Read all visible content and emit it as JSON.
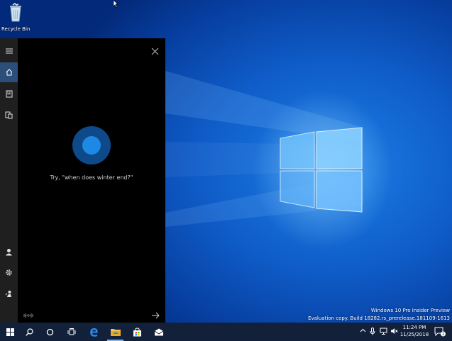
{
  "desktop": {
    "icons": [
      {
        "label": "Recycle Bin",
        "icon": "recycle-bin-icon"
      }
    ]
  },
  "cortana": {
    "suggestion": "Try, \"when does winter end?\"",
    "rail_top": [
      "hamburger-menu-icon",
      "home-icon",
      "notebook-icon",
      "devices-icon"
    ],
    "rail_bottom": [
      "account-icon",
      "settings-icon",
      "feedback-icon"
    ],
    "accent": "#1e88e5"
  },
  "watermark": {
    "line1": "Windows 10 Pro Insider Preview",
    "line2": "Evaluation copy. Build 18282.rs_prerelease.181109-1613"
  },
  "taskbar": {
    "items": [
      "start-icon",
      "search-icon",
      "cortana-icon",
      "task-view-icon",
      "edge-icon",
      "file-explorer-icon",
      "store-icon",
      "mail-icon"
    ],
    "tray": [
      "chevron-up-icon",
      "microphone-icon",
      "network-icon",
      "volume-muted-icon"
    ],
    "time": "11:24 PM",
    "date": "11/25/2018",
    "notification_count": "1"
  }
}
